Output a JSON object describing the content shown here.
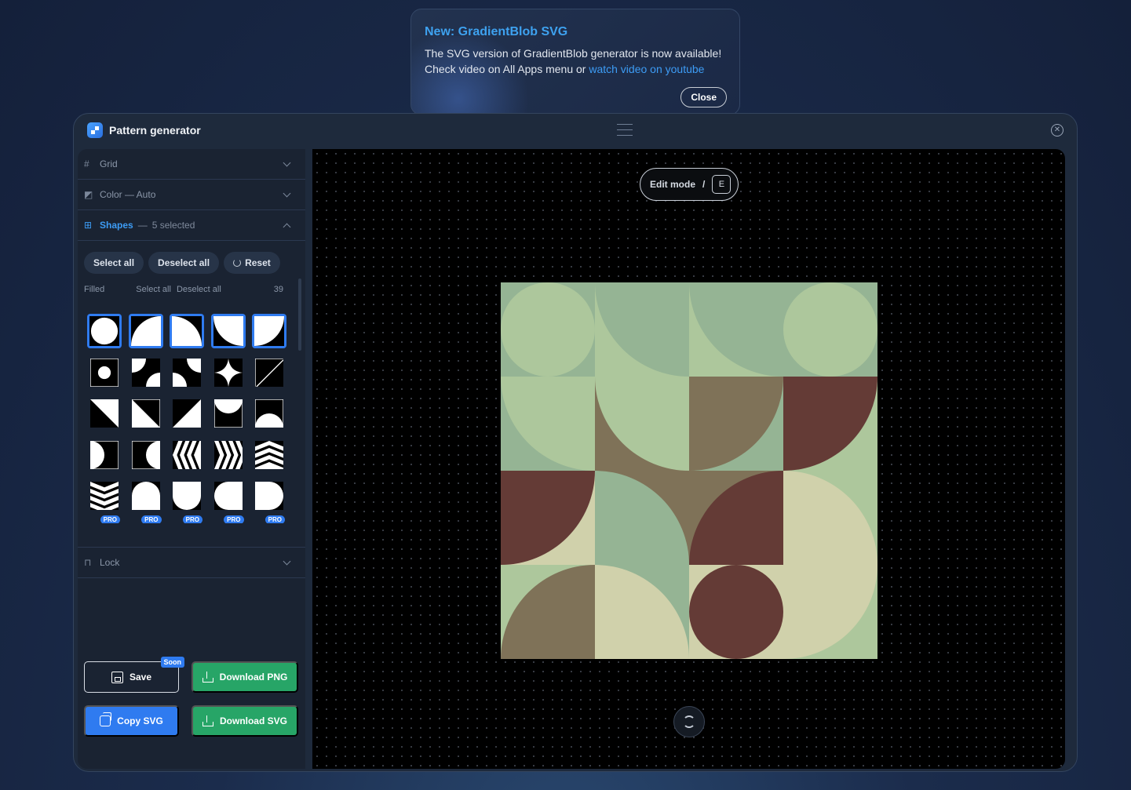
{
  "notice": {
    "title": "New: GradientBlob SVG",
    "line1": "The SVG version of GradientBlob generator is now available!",
    "line2_prefix": "Check video on All Apps menu or ",
    "line2_link": "watch video on youtube",
    "close_label": "Close"
  },
  "window": {
    "title": "Pattern generator",
    "icons": {
      "app": "pattern-logo-icon",
      "menu": "hamburger-icon",
      "close": "close-circle-icon"
    }
  },
  "sidebar": {
    "grid": {
      "label": "Grid",
      "icon": "hash-icon"
    },
    "color": {
      "label": "Color — Auto",
      "icon": "palette-icon"
    },
    "shapes": {
      "label": "Shapes",
      "separator": "—",
      "selected_text": "5 selected",
      "icon": "grid-icon"
    },
    "buttons": {
      "select_all": "Select all",
      "deselect_all": "Deselect all",
      "reset": "Reset"
    },
    "filled": {
      "label": "Filled",
      "select_all": "Select all",
      "deselect_all": "Deselect all",
      "count": "39"
    },
    "pro_badge": "PRO",
    "lock": {
      "label": "Lock",
      "icon": "lock-icon"
    },
    "actions": {
      "save": "Save",
      "soon_badge": "Soon",
      "download_png": "Download PNG",
      "copy_svg": "Copy SVG",
      "download_svg": "Download SVG"
    }
  },
  "canvas": {
    "edit_mode_label": "Edit mode",
    "edit_mode_sep": "/",
    "edit_mode_key": "E",
    "colors": {
      "sage": "#adc79c",
      "green": "#95b494",
      "cream": "#d0d1ab",
      "brown": "#7f7258",
      "maroon": "#643b36"
    }
  }
}
